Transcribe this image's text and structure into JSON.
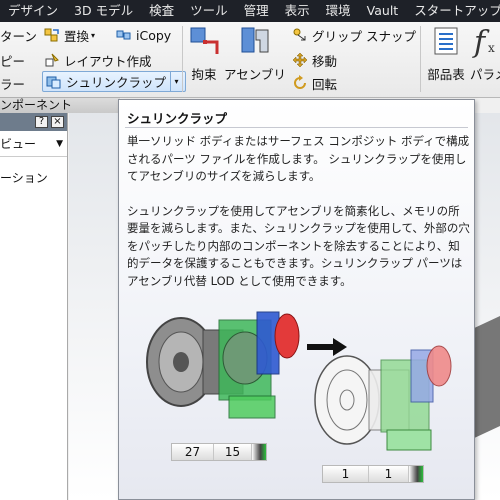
{
  "menubar": {
    "items": [
      "デザイン",
      "3D モデル",
      "検査",
      "ツール",
      "管理",
      "表示",
      "環境",
      "Vault",
      "スタートアップ"
    ]
  },
  "ribbon": {
    "pattern_label": "ターン",
    "replace_label": "置換",
    "icopy_label": "iCopy",
    "copy_label": "ピー",
    "layout_label": "レイアウト作成",
    "mirror_label": "ラー",
    "shrinkwrap_label": "シュリンクラップ",
    "constrain_label": "拘束",
    "assemble_label": "アセンブリ",
    "grip_snap_label": "グリップ スナップ",
    "move_label": "移動",
    "rotate_label": "回転",
    "bom_label": "部品表",
    "params_label": "パラメ",
    "panel_label": "ンポーネント"
  },
  "browser": {
    "help_label": "?",
    "close_label": "×",
    "view_label": "ビュー",
    "tree_item": "ーション"
  },
  "tooltip": {
    "title": "シュリンクラップ",
    "paragraph1": "単一ソリッド ボディまたはサーフェス コンポジット ボディで構成されるパーツ ファイルを作成します。 シュリンクラップを使用してアセンブリのサイズを減らします。",
    "paragraph2": "シュリンクラップを使用してアセンブリを簡素化し、メモリの所要量を減らします。また、シュリンクラップを使用して、外部の穴をパッチしたり内部のコンポーネントを除去することにより、知的データを保護することもできます。シュリンクラップ パーツはアセンブリ代替 LOD として使用できます。",
    "before_counts": [
      "27",
      "15"
    ],
    "after_counts": [
      "1",
      "1"
    ]
  },
  "colors": {
    "menubar_bg": "#1e2128",
    "ribbon_highlight": "#cfe4fb",
    "tooltip_border": "#8a8f99"
  }
}
